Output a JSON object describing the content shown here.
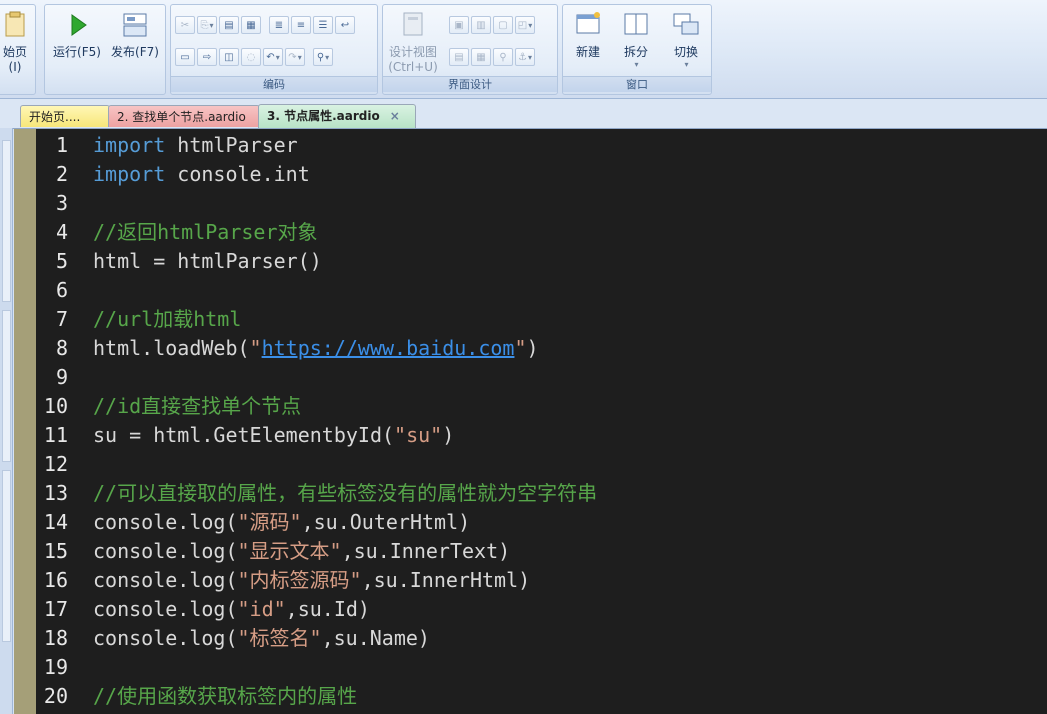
{
  "ribbon": {
    "home_partial": "始页(I)",
    "run_label": "运行(F5)",
    "publish_label": "发布(F7)",
    "edit_group_label": "编码",
    "design_view_label": "设计视图",
    "design_view_shortcut": "(Ctrl+U)",
    "ui_design_group_label": "界面设计",
    "new_label": "新建",
    "split_label": "拆分",
    "switch_label": "切换",
    "window_group_label": "窗口"
  },
  "tabs": [
    {
      "label": "开始页...."
    },
    {
      "label": "2. 查找单个节点.aardio"
    },
    {
      "label": "3. 节点属性.aardio",
      "close": "×"
    }
  ],
  "colors": {
    "editor_bg": "#1e1e1e",
    "keyword": "#569cd6",
    "comment": "#57a64a",
    "string": "#d69d85",
    "link": "#3b8fe8"
  },
  "code": {
    "lines": [
      {
        "n": "1",
        "parts": [
          {
            "t": "kw",
            "s": "import"
          },
          {
            "t": "tx",
            "s": " htmlParser"
          }
        ]
      },
      {
        "n": "2",
        "parts": [
          {
            "t": "kw",
            "s": "import"
          },
          {
            "t": "tx",
            "s": " console.int"
          }
        ]
      },
      {
        "n": "3",
        "parts": []
      },
      {
        "n": "4",
        "parts": [
          {
            "t": "cm",
            "s": "//返回htmlParser对象"
          }
        ]
      },
      {
        "n": "5",
        "parts": [
          {
            "t": "tx",
            "s": "html = htmlParser()"
          }
        ]
      },
      {
        "n": "6",
        "parts": []
      },
      {
        "n": "7",
        "parts": [
          {
            "t": "cm",
            "s": "//url加载html"
          }
        ]
      },
      {
        "n": "8",
        "parts": [
          {
            "t": "tx",
            "s": "html.loadWeb("
          },
          {
            "t": "st",
            "s": "\""
          },
          {
            "t": "url",
            "s": "https://www.baidu.com"
          },
          {
            "t": "st",
            "s": "\""
          },
          {
            "t": "tx",
            "s": ")"
          }
        ]
      },
      {
        "n": "9",
        "parts": []
      },
      {
        "n": "10",
        "parts": [
          {
            "t": "cm",
            "s": "//id直接查找单个节点"
          }
        ]
      },
      {
        "n": "11",
        "parts": [
          {
            "t": "tx",
            "s": "su = html.GetElementbyId("
          },
          {
            "t": "st",
            "s": "\"su\""
          },
          {
            "t": "tx",
            "s": ")"
          }
        ]
      },
      {
        "n": "12",
        "parts": []
      },
      {
        "n": "13",
        "parts": [
          {
            "t": "cm",
            "s": "//可以直接取的属性，有些标签没有的属性就为空字符串"
          }
        ]
      },
      {
        "n": "14",
        "parts": [
          {
            "t": "tx",
            "s": "console.log("
          },
          {
            "t": "st",
            "s": "\"源码\""
          },
          {
            "t": "tx",
            "s": ",su.OuterHtml)"
          }
        ]
      },
      {
        "n": "15",
        "parts": [
          {
            "t": "tx",
            "s": "console.log("
          },
          {
            "t": "st",
            "s": "\"显示文本\""
          },
          {
            "t": "tx",
            "s": ",su.InnerText)"
          }
        ]
      },
      {
        "n": "16",
        "parts": [
          {
            "t": "tx",
            "s": "console.log("
          },
          {
            "t": "st",
            "s": "\"内标签源码\""
          },
          {
            "t": "tx",
            "s": ",su.InnerHtml)"
          }
        ]
      },
      {
        "n": "17",
        "parts": [
          {
            "t": "tx",
            "s": "console.log("
          },
          {
            "t": "st",
            "s": "\"id\""
          },
          {
            "t": "tx",
            "s": ",su.Id)"
          }
        ]
      },
      {
        "n": "18",
        "parts": [
          {
            "t": "tx",
            "s": "console.log("
          },
          {
            "t": "st",
            "s": "\"标签名\""
          },
          {
            "t": "tx",
            "s": ",su.Name)"
          }
        ]
      },
      {
        "n": "19",
        "parts": []
      },
      {
        "n": "20",
        "parts": [
          {
            "t": "cm",
            "s": "//使用函数获取标签内的属性"
          }
        ]
      }
    ]
  }
}
